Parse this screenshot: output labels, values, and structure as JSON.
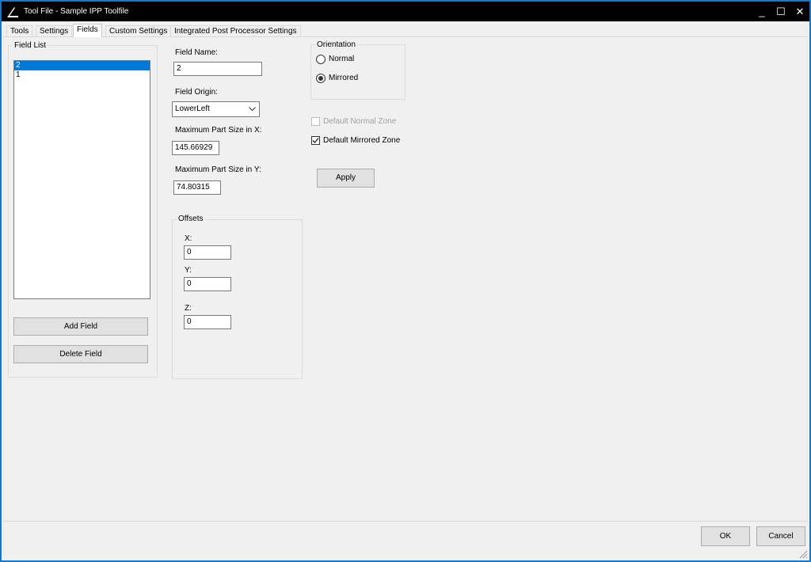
{
  "window": {
    "title": "Tool File - Sample IPP Toolfile",
    "minimize_glyph": "_",
    "maximize_glyph": "☐",
    "close_glyph": "✕"
  },
  "tabs": [
    {
      "label": "Tools",
      "active": false
    },
    {
      "label": "Settings",
      "active": false
    },
    {
      "label": "Fields",
      "active": true
    },
    {
      "label": "Custom Settings",
      "active": false
    },
    {
      "label": "Integrated Post Processor Settings",
      "active": false
    }
  ],
  "field_list": {
    "label": "Field List",
    "items": [
      {
        "label": "2",
        "selected": true
      },
      {
        "label": "1",
        "selected": false
      }
    ],
    "add_button": "Add Field",
    "delete_button": "Delete Field"
  },
  "form": {
    "field_name_label": "Field Name:",
    "field_name_value": "2",
    "field_origin_label": "Field Origin:",
    "field_origin_value": "LowerLeft",
    "max_x_label": "Maximum Part Size in X:",
    "max_x_value": "145.66929",
    "max_y_label": "Maximum Part Size in Y:",
    "max_y_value": "74.80315"
  },
  "offsets": {
    "label": "Offsets",
    "x_label": "X:",
    "x_value": "0",
    "y_label": "Y:",
    "y_value": "0",
    "z_label": "Z:",
    "z_value": "0"
  },
  "orientation": {
    "label": "Orientation",
    "normal_label": "Normal",
    "mirrored_label": "Mirrored",
    "selected": "Mirrored"
  },
  "zones": {
    "default_normal_label": "Default Normal Zone",
    "default_normal_checked": false,
    "default_normal_enabled": false,
    "default_mirrored_label": "Default Mirrored Zone",
    "default_mirrored_checked": true
  },
  "apply_button": "Apply",
  "footer": {
    "ok_button": "OK",
    "cancel_button": "Cancel"
  },
  "colors": {
    "selection": "#0078d7",
    "titlebar": "#000000",
    "window_border": "#1b75c9"
  }
}
